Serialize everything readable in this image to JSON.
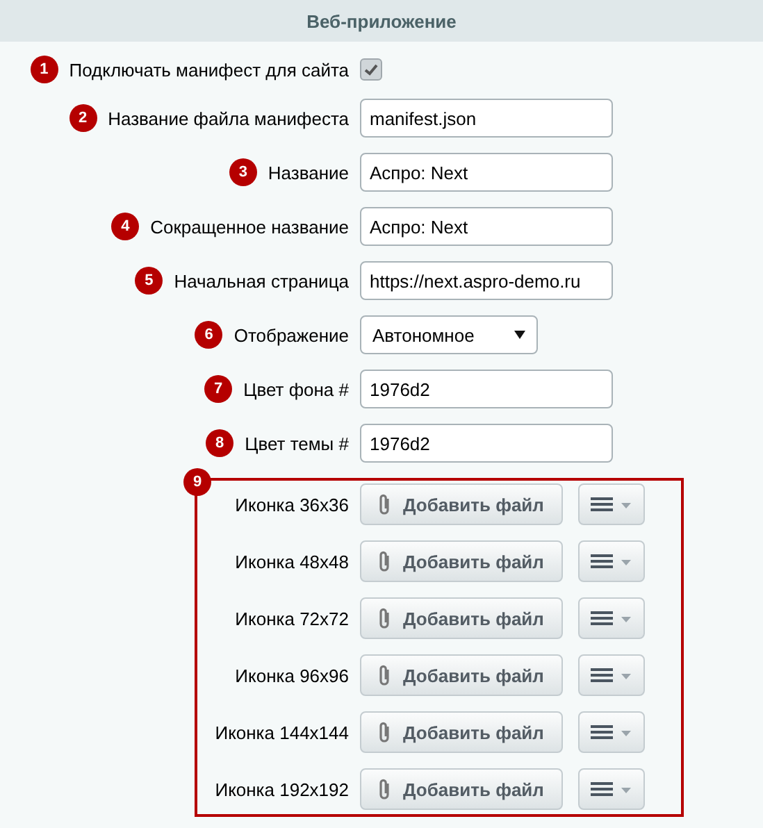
{
  "header": {
    "title": "Веб-приложение"
  },
  "fields": [
    {
      "badge": "1",
      "label": "Подключать манифест для сайта",
      "kind": "checkbox",
      "checked": true
    },
    {
      "badge": "2",
      "label": "Название файла манифеста",
      "kind": "text",
      "value": "manifest.json"
    },
    {
      "badge": "3",
      "label": "Название",
      "kind": "text",
      "value": "Аспро: Next"
    },
    {
      "badge": "4",
      "label": "Сокращенное название",
      "kind": "text",
      "value": "Аспро: Next"
    },
    {
      "badge": "5",
      "label": "Начальная страница",
      "kind": "text",
      "value": "https://next.aspro-demo.ru"
    },
    {
      "badge": "6",
      "label": "Отображение",
      "kind": "select",
      "value": "Автономное"
    },
    {
      "badge": "7",
      "label": "Цвет фона #",
      "kind": "text",
      "value": "1976d2"
    },
    {
      "badge": "8",
      "label": "Цвет темы #",
      "kind": "text",
      "value": "1976d2"
    }
  ],
  "icons_group": {
    "badge": "9",
    "rows": [
      {
        "label": "Иконка 36x36",
        "button": "Добавить файл"
      },
      {
        "label": "Иконка 48x48",
        "button": "Добавить файл"
      },
      {
        "label": "Иконка 72x72",
        "button": "Добавить файл"
      },
      {
        "label": "Иконка 96x96",
        "button": "Добавить файл"
      },
      {
        "label": "Иконка 144x144",
        "button": "Добавить файл"
      },
      {
        "label": "Иконка 192x192",
        "button": "Добавить файл"
      }
    ]
  }
}
